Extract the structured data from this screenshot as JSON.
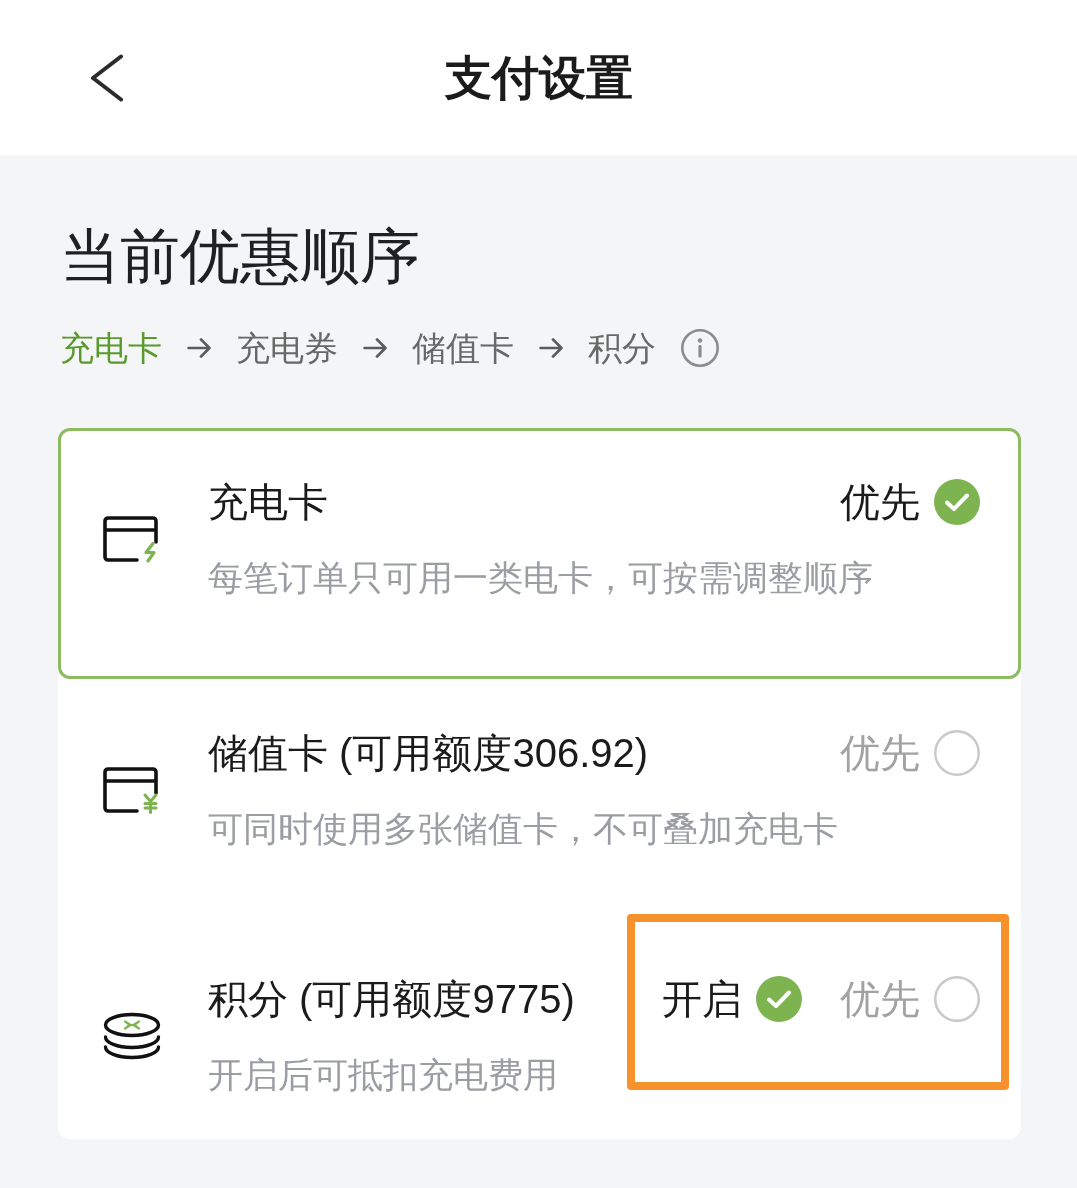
{
  "header": {
    "title": "支付设置"
  },
  "section": {
    "heading": "当前优惠顺序",
    "order": [
      {
        "label": "充电卡",
        "active": true
      },
      {
        "label": "充电券",
        "active": false
      },
      {
        "label": "储值卡",
        "active": false
      },
      {
        "label": "积分",
        "active": false
      }
    ]
  },
  "options": [
    {
      "kind": "charge-card",
      "title": "充电卡",
      "description": "每笔订单只可用一类电卡，可按需调整顺序",
      "selected": true,
      "highlighted": false,
      "priority": {
        "label": "优先",
        "checked": true
      }
    },
    {
      "kind": "stored-value",
      "title": "储值卡 (可用额度306.92)",
      "description": "可同时使用多张储值卡，不可叠加充电卡",
      "selected": false,
      "highlighted": false,
      "priority": {
        "label": "优先",
        "checked": false
      }
    },
    {
      "kind": "points",
      "title": "积分 (可用额度9775)",
      "description": "开启后可抵扣充电费用",
      "selected": false,
      "highlighted": true,
      "toggle": {
        "label": "开启",
        "checked": true
      },
      "priority": {
        "label": "优先",
        "checked": false
      }
    }
  ]
}
